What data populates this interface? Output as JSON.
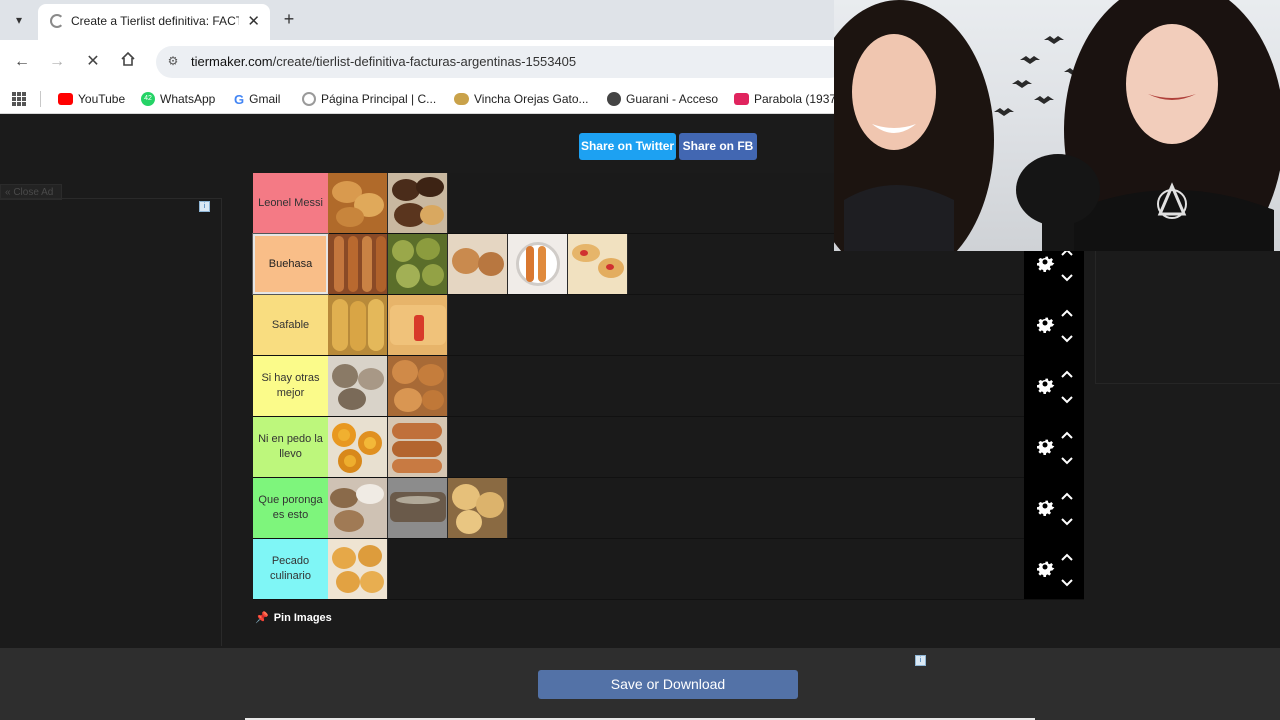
{
  "browser": {
    "tab_title": "Create a Tierlist definitiva: FACT",
    "url_host": "tiermaker.com",
    "url_path": "/create/tierlist-definitiva-facturas-argentinas-1553405",
    "bookmarks": [
      {
        "label": "YouTube",
        "icon_color": "#ff0000"
      },
      {
        "label": "WhatsApp",
        "icon_color": "#25d366",
        "badge": "42"
      },
      {
        "label": "Gmail",
        "icon_color": "#4285f4"
      },
      {
        "label": "Página Principal | C...",
        "icon_color": "#9a9a9a"
      },
      {
        "label": "Vincha Orejas Gato...",
        "icon_color": "#c9a24a"
      },
      {
        "label": "Guarani - Acceso",
        "icon_color": "#444444"
      },
      {
        "label": "Parabola (1937)",
        "icon_color": "#e0245e"
      }
    ]
  },
  "page": {
    "share_twitter": "Share on Twitter",
    "share_fb": "Share on FB",
    "close_ad": "« Close Ad",
    "adchoice": "i",
    "pin_images": "Pin Images",
    "save_button": "Save or Download"
  },
  "tiers": [
    {
      "label": "Leonel Messi",
      "color": "#f47a85",
      "items": [
        "medialuna-brioche",
        "berlinesa-chocolate"
      ]
    },
    {
      "label": "Buehasa",
      "color": "#f9be88",
      "selected": true,
      "items": [
        "churros",
        "bolitas-de-fraile",
        "caracoles",
        "churros-dulce-de-leche",
        "vigilantes-membrillo"
      ]
    },
    {
      "label": "Safable",
      "color": "#f9dd80",
      "items": [
        "cuernitos",
        "pastafrola-bizcocho"
      ]
    },
    {
      "label": "Si hay otras mejor",
      "color": "#fbfb8a",
      "items": [
        "tortitas-negras",
        "medialunas-grasa"
      ]
    },
    {
      "label": "Ni en pedo la llevo",
      "color": "#bdf77c",
      "items": [
        "rosquitas",
        "cañoncitos"
      ]
    },
    {
      "label": "Que poronga es esto",
      "color": "#7ef57c",
      "items": [
        "sacramentos",
        "palmeritas",
        "pan-de-leche"
      ]
    },
    {
      "label": "Pecado culinario",
      "color": "#7ff6f6",
      "items": [
        "bolas-de-fraile"
      ]
    }
  ],
  "colors": {
    "twitter": "#1da1f2",
    "facebook": "#4267b2",
    "save": "#5372a7"
  }
}
